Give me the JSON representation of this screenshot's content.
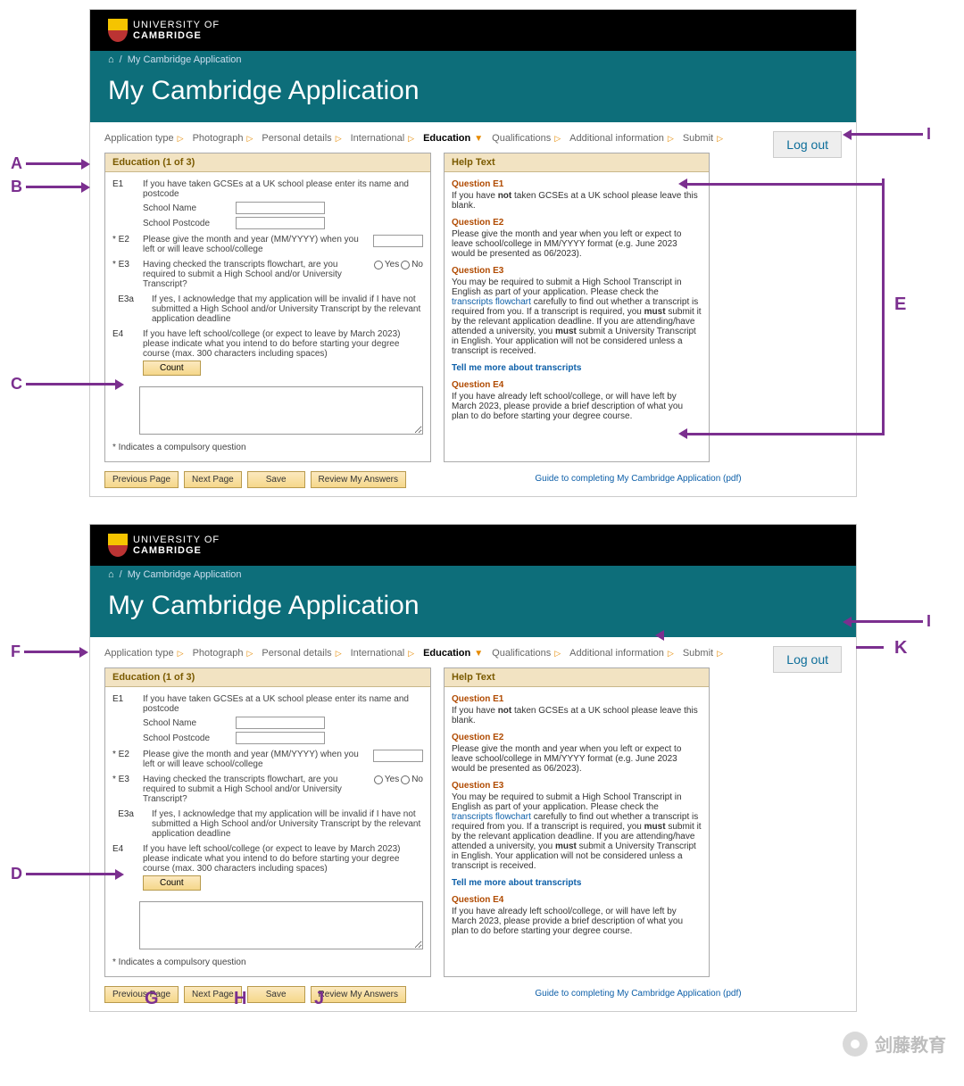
{
  "annotations": {
    "A": "A",
    "B": "B",
    "C": "C",
    "D": "D",
    "E": "E",
    "F": "F",
    "G": "G",
    "H": "H",
    "I": "I",
    "J": "J",
    "K": "K"
  },
  "logo": {
    "line1": "UNIVERSITY OF",
    "line2": "CAMBRIDGE"
  },
  "breadcrumb": {
    "sep": "/",
    "current": "My Cambridge Application"
  },
  "title": "My Cambridge Application",
  "nav": [
    "Application type",
    "Photograph",
    "Personal details",
    "International",
    "Education",
    "Qualifications",
    "Additional information",
    "Submit"
  ],
  "logout_label": "Log out",
  "panel_title": "Education (1 of 3)",
  "questions": {
    "e1": {
      "id": "E1",
      "text": "If you have taken GCSEs at a UK school please enter its name and postcode",
      "school_name": "School Name",
      "school_postcode": "School Postcode"
    },
    "e2": {
      "id": "* E2",
      "text": "Please give the month and year (MM/YYYY) when you left or will leave school/college"
    },
    "e3": {
      "id": "* E3",
      "text": "Having checked the transcripts flowchart, are you required to submit a High School and/or University Transcript?",
      "yes": "Yes",
      "no": "No"
    },
    "e3a": {
      "id": "E3a",
      "text": "If yes, I acknowledge that my application will be invalid if I have not submitted a High School and/or University Transcript by the relevant application deadline"
    },
    "e4": {
      "id": "E4",
      "text": "If you have left school/college (or expect to leave by March 2023) please indicate what you intend to do before starting your degree course (max. 300 characters including spaces)",
      "count": "Count"
    }
  },
  "compulsory_note": "* Indicates a compulsory question",
  "actions": {
    "prev": "Previous Page",
    "next": "Next Page",
    "save": "Save",
    "review": "Review My Answers"
  },
  "help": {
    "title": "Help Text",
    "q1": {
      "h": "Question E1",
      "t1": "If you have ",
      "not": "not",
      "t2": " taken GCSEs at a UK school please leave this blank."
    },
    "q2": {
      "h": "Question E2",
      "t": "Please give the month and year when you left or expect to leave school/college in MM/YYYY format (e.g. June 2023 would be presented as 06/2023)."
    },
    "q3": {
      "h": "Question E3",
      "t1": "You may be required to submit a High School Transcript in English as part of your application. Please check the ",
      "link1": "transcripts flowchart",
      "t2": " carefully to find out whether a transcript is required from you. If a transcript is required, you ",
      "must": "must",
      "t3": " submit it by the relevant application deadline. If you are attending/have attended a university, you ",
      "t4": " submit a University Transcript in English. Your application will not be considered unless a transcript is received.",
      "link2": "Tell me more about transcripts"
    },
    "q4": {
      "h": "Question E4",
      "t": "If you have already left school/college, or will have left by March 2023, please provide a brief description of what you plan to do before starting your degree course."
    },
    "guide": "Guide to completing My Cambridge Application (pdf)"
  },
  "watermark": "剑藤教育"
}
